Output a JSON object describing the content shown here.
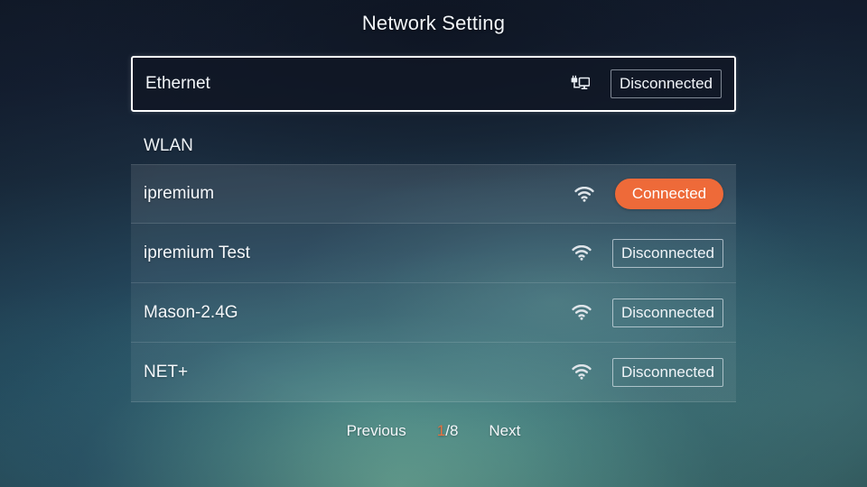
{
  "header": {
    "title": "Network Setting"
  },
  "ethernet": {
    "label": "Ethernet",
    "icon": "ethernet-icon",
    "status": "Disconnected"
  },
  "wlan": {
    "section_label": "WLAN",
    "networks": [
      {
        "ssid": "ipremium",
        "icon": "wifi-icon",
        "status": "Connected",
        "connected": true
      },
      {
        "ssid": "ipremium Test",
        "icon": "wifi-icon",
        "status": "Disconnected",
        "connected": false
      },
      {
        "ssid": "Mason-2.4G",
        "icon": "wifi-icon",
        "status": "Disconnected",
        "connected": false
      },
      {
        "ssid": "NET+",
        "icon": "wifi-icon",
        "status": "Disconnected",
        "connected": false
      }
    ]
  },
  "pager": {
    "previous_label": "Previous",
    "next_label": "Next",
    "current_page": "1",
    "separator_total": "/8"
  },
  "colors": {
    "accent_orange": "#ee6a39",
    "text_primary": "#f2f5f8",
    "focus_border": "#ffffff"
  }
}
